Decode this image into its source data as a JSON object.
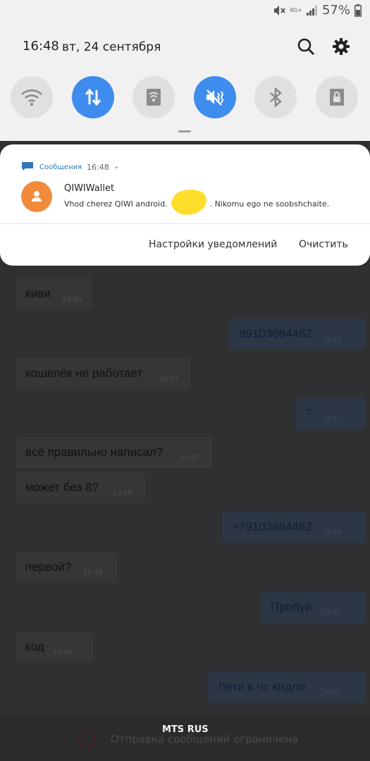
{
  "status_bar": {
    "network": "4G+",
    "battery": "57%"
  },
  "header": {
    "time": "16:48",
    "date": "вт, 24 сентября"
  },
  "quick_settings": [
    {
      "name": "wifi-icon",
      "on": false
    },
    {
      "name": "mobile-data-icon",
      "on": true
    },
    {
      "name": "nfc-icon",
      "on": false
    },
    {
      "name": "vibrate-mute-icon",
      "on": true
    },
    {
      "name": "bluetooth-icon",
      "on": false
    },
    {
      "name": "secure-folder-icon",
      "on": false
    }
  ],
  "notification": {
    "app": "Сообщения",
    "time": "16:48",
    "sender": "QIWIWallet",
    "text_start": "Vhod cherez QIWI android.",
    "text_end": ". Nikomu ego ne soobshchaite.",
    "settings_button": "Настройки уведомлений",
    "clear_button": "Очистить"
  },
  "messages": [
    {
      "text": "киви",
      "time": "16:46",
      "dir": "in"
    },
    {
      "text": "89103684462",
      "time": "16:46",
      "dir": "out"
    },
    {
      "text": "кошелёк не работает",
      "time": "16:47",
      "dir": "in"
    },
    {
      "text": "?",
      "time": "16:47",
      "dir": "out"
    },
    {
      "text": "всё правильно написал?",
      "time": "16:47",
      "dir": "in"
    },
    {
      "text": "может без 8?",
      "time": "16:48",
      "dir": "in"
    },
    {
      "text": "+79103684462",
      "time": "16:48",
      "dir": "out"
    },
    {
      "text": "первой?",
      "time": "16:48",
      "dir": "in"
    },
    {
      "text": "Пробуй",
      "time": "16:48",
      "dir": "out"
    },
    {
      "text": "код",
      "time": "16:48",
      "dir": "in"
    },
    {
      "text": "Лети в чс кидло",
      "time": "16:48",
      "dir": "out"
    }
  ],
  "bottom": {
    "warning": "Отправка сообщений ограничена",
    "carrier": "MTS RUS"
  }
}
